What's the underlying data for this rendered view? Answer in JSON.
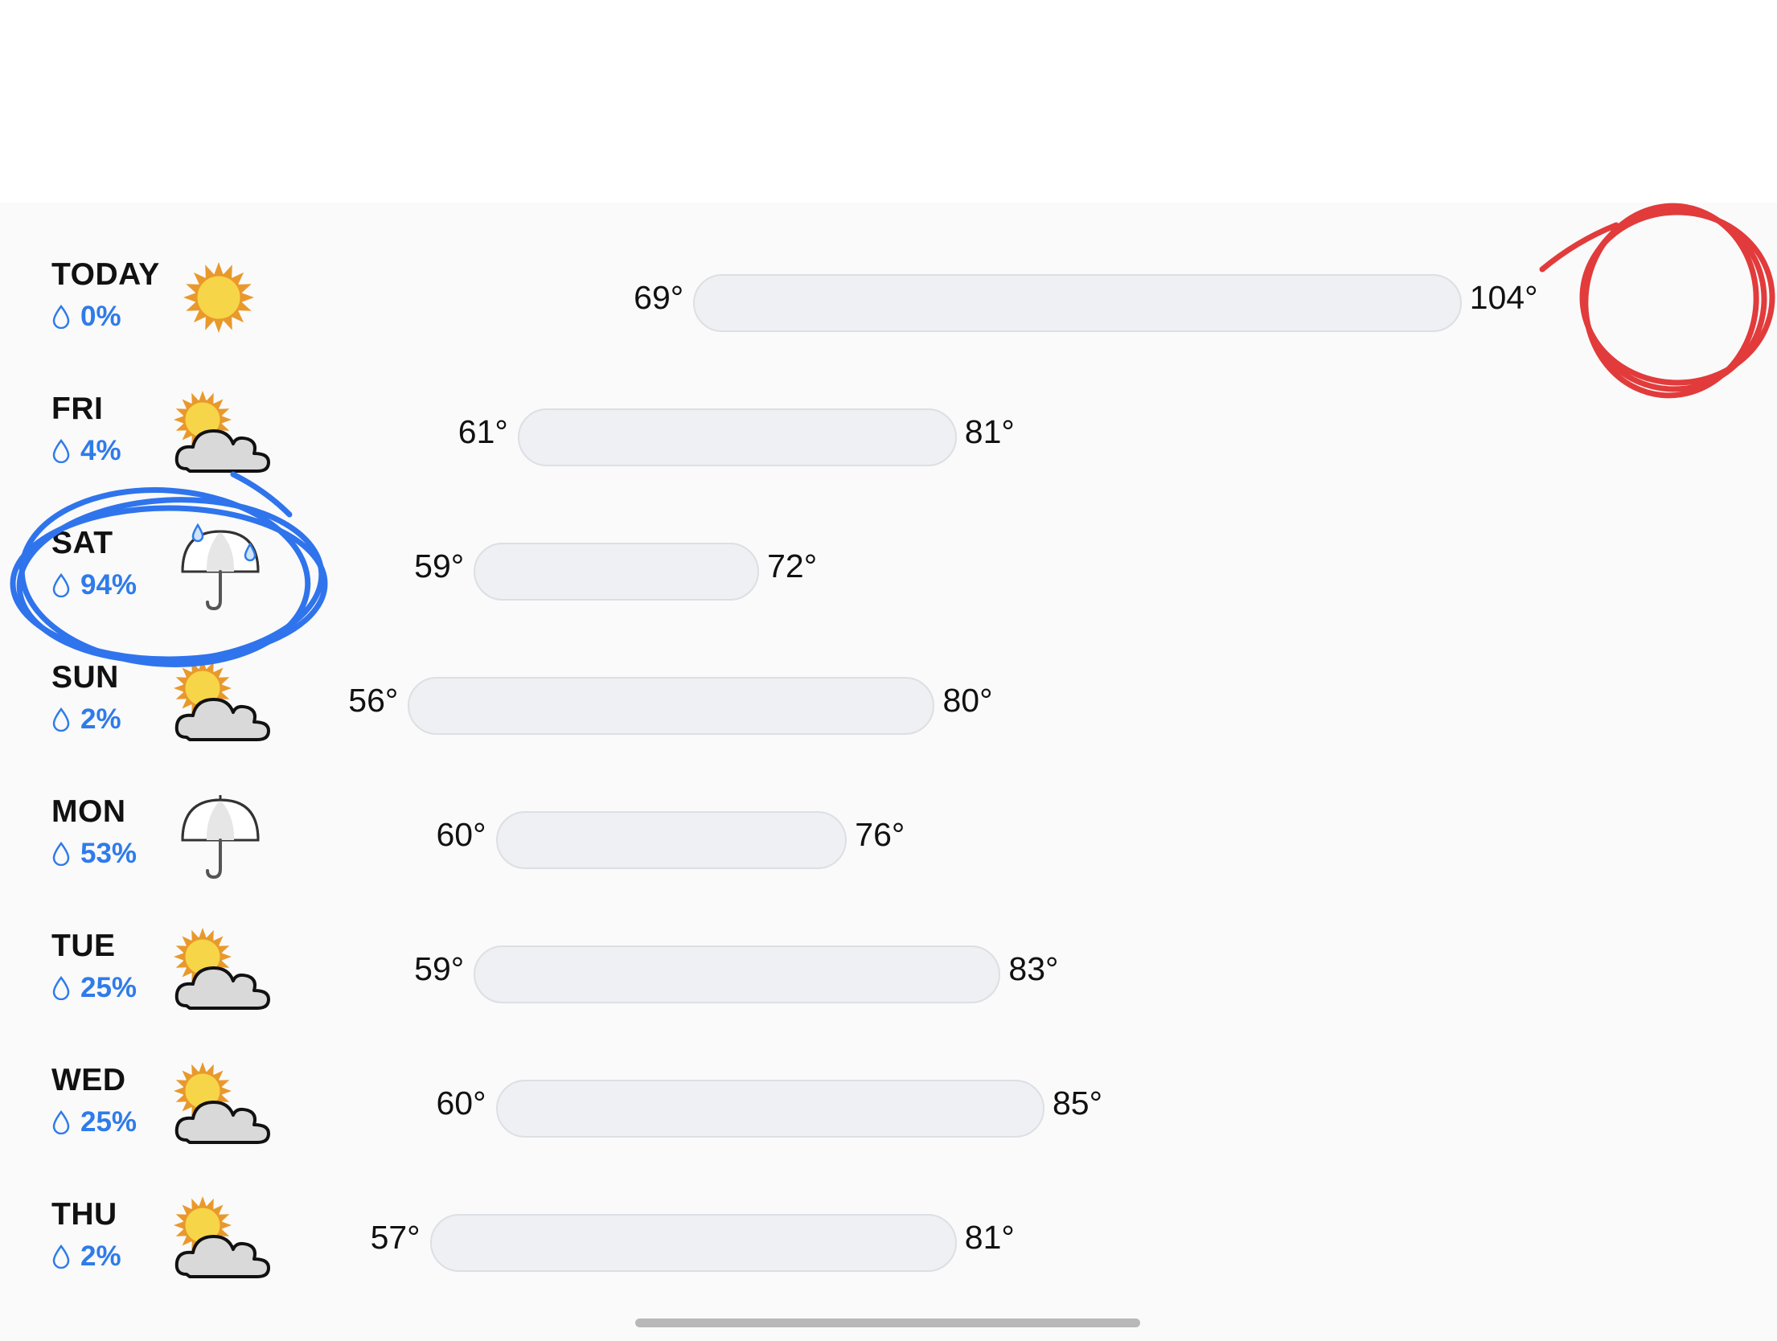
{
  "forecast": {
    "scale": {
      "min_temp": 55,
      "max_temp": 105
    },
    "days": [
      {
        "day": "TODAY",
        "precip": "0%",
        "icon": "sun-icon",
        "low": "69°",
        "high": "104°",
        "low_value": 69,
        "high_value": 104
      },
      {
        "day": "FRI",
        "precip": "4%",
        "icon": "partly-cloudy-icon",
        "low": "61°",
        "high": "81°",
        "low_value": 61,
        "high_value": 81
      },
      {
        "day": "SAT",
        "precip": "94%",
        "icon": "rain-umbrella-icon",
        "low": "59°",
        "high": "72°",
        "low_value": 59,
        "high_value": 72
      },
      {
        "day": "SUN",
        "precip": "2%",
        "icon": "partly-cloudy-icon",
        "low": "56°",
        "high": "80°",
        "low_value": 56,
        "high_value": 80
      },
      {
        "day": "MON",
        "precip": "53%",
        "icon": "umbrella-icon",
        "low": "60°",
        "high": "76°",
        "low_value": 60,
        "high_value": 76
      },
      {
        "day": "TUE",
        "precip": "25%",
        "icon": "partly-cloudy-icon",
        "low": "59°",
        "high": "83°",
        "low_value": 59,
        "high_value": 83
      },
      {
        "day": "WED",
        "precip": "25%",
        "icon": "partly-cloudy-icon",
        "low": "60°",
        "high": "85°",
        "low_value": 60,
        "high_value": 85
      },
      {
        "day": "THU",
        "precip": "2%",
        "icon": "partly-cloudy-icon",
        "low": "57°",
        "high": "81°",
        "low_value": 57,
        "high_value": 81
      }
    ]
  },
  "colors": {
    "precip_text": "#2f7bea",
    "bar_fill": "#eef0f3",
    "sun": "#f7d548",
    "sun_rays": "#e9992b",
    "cloud": "#d9d9d9",
    "red_annotation": "#e23b3b",
    "blue_annotation": "#2f74ec"
  }
}
